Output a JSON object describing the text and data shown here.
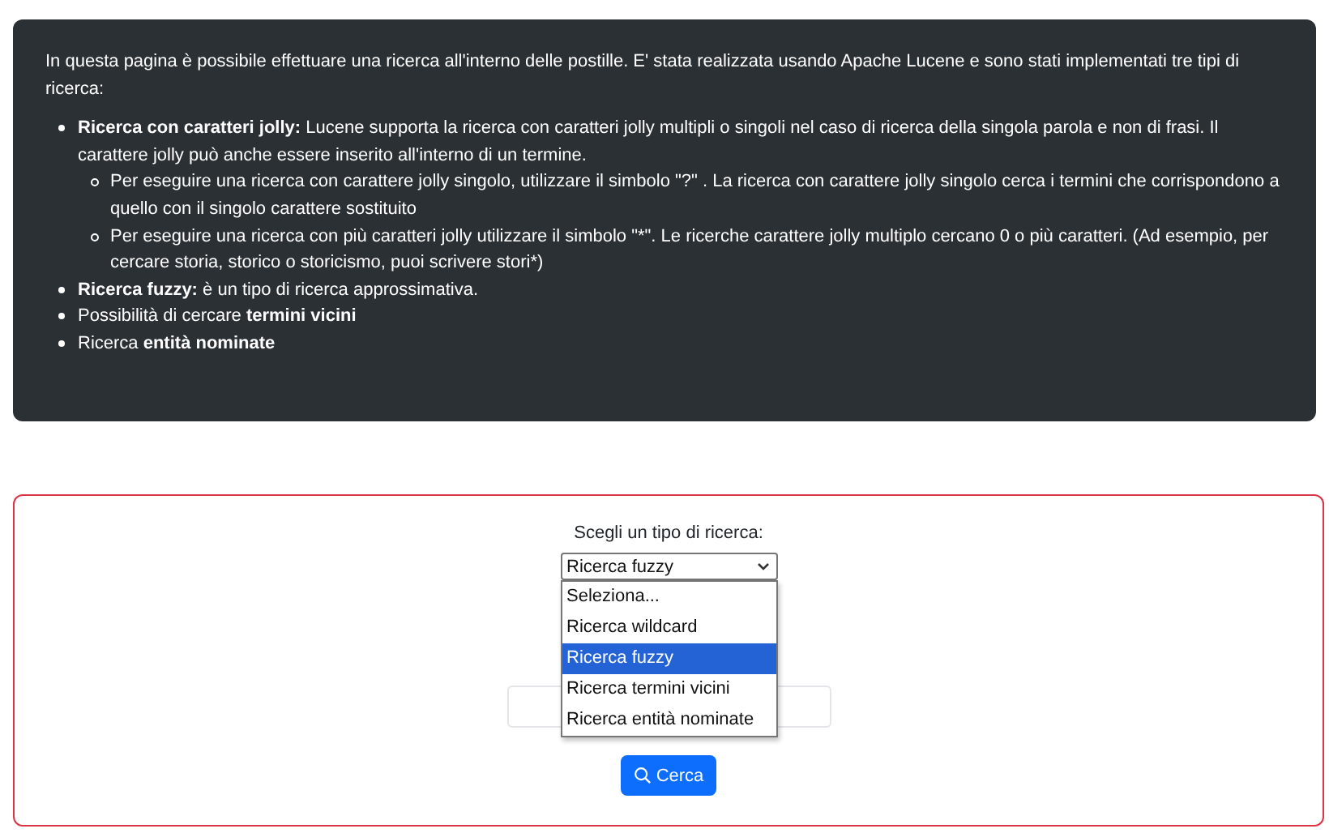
{
  "info_panel": {
    "intro": "In questa pagina è possibile effettuare una ricerca all'interno delle postille. E' stata realizzata usando Apache Lucene e sono stati implementati tre tipi di ricerca:",
    "items": [
      {
        "text": "**Ricerca con caratteri jolly:** Lucene supporta la ricerca con caratteri jolly multipli o singoli nel caso di ricerca della singola parola e non di frasi. Il carattere jolly può anche essere inserito all'interno di un termine.",
        "children": [
          {
            "text": "Per eseguire una ricerca con carattere jolly singolo, utilizzare il simbolo \"?\" . La ricerca con carattere jolly singolo cerca i termini che corrispondono a quello con il singolo carattere sostituito"
          },
          {
            "text": "Per eseguire una ricerca con più caratteri jolly utilizzare il simbolo \"*\". Le ricerche carattere jolly multiplo cercano 0 o più caratteri. (Ad esempio, per cercare storia, storico o storicismo, puoi scrivere stori*)"
          }
        ]
      },
      {
        "text": "**Ricerca fuzzy:** è un tipo di ricerca approssimativa."
      },
      {
        "text": "Possibilità di cercare **termini vicini**"
      },
      {
        "text": "Ricerca **entità nominate**"
      }
    ]
  },
  "search_form": {
    "label": "Scegli un tipo di ricerca:",
    "select": {
      "value": "Ricerca fuzzy",
      "expanded": true,
      "options": [
        {
          "label": "Seleziona...",
          "selected": false
        },
        {
          "label": "Ricerca wildcard",
          "selected": false
        },
        {
          "label": "Ricerca fuzzy",
          "selected": true
        },
        {
          "label": "Ricerca termini vicini",
          "selected": false
        },
        {
          "label": "Ricerca entità nominate",
          "selected": false
        }
      ]
    },
    "button": "Cerca"
  }
}
